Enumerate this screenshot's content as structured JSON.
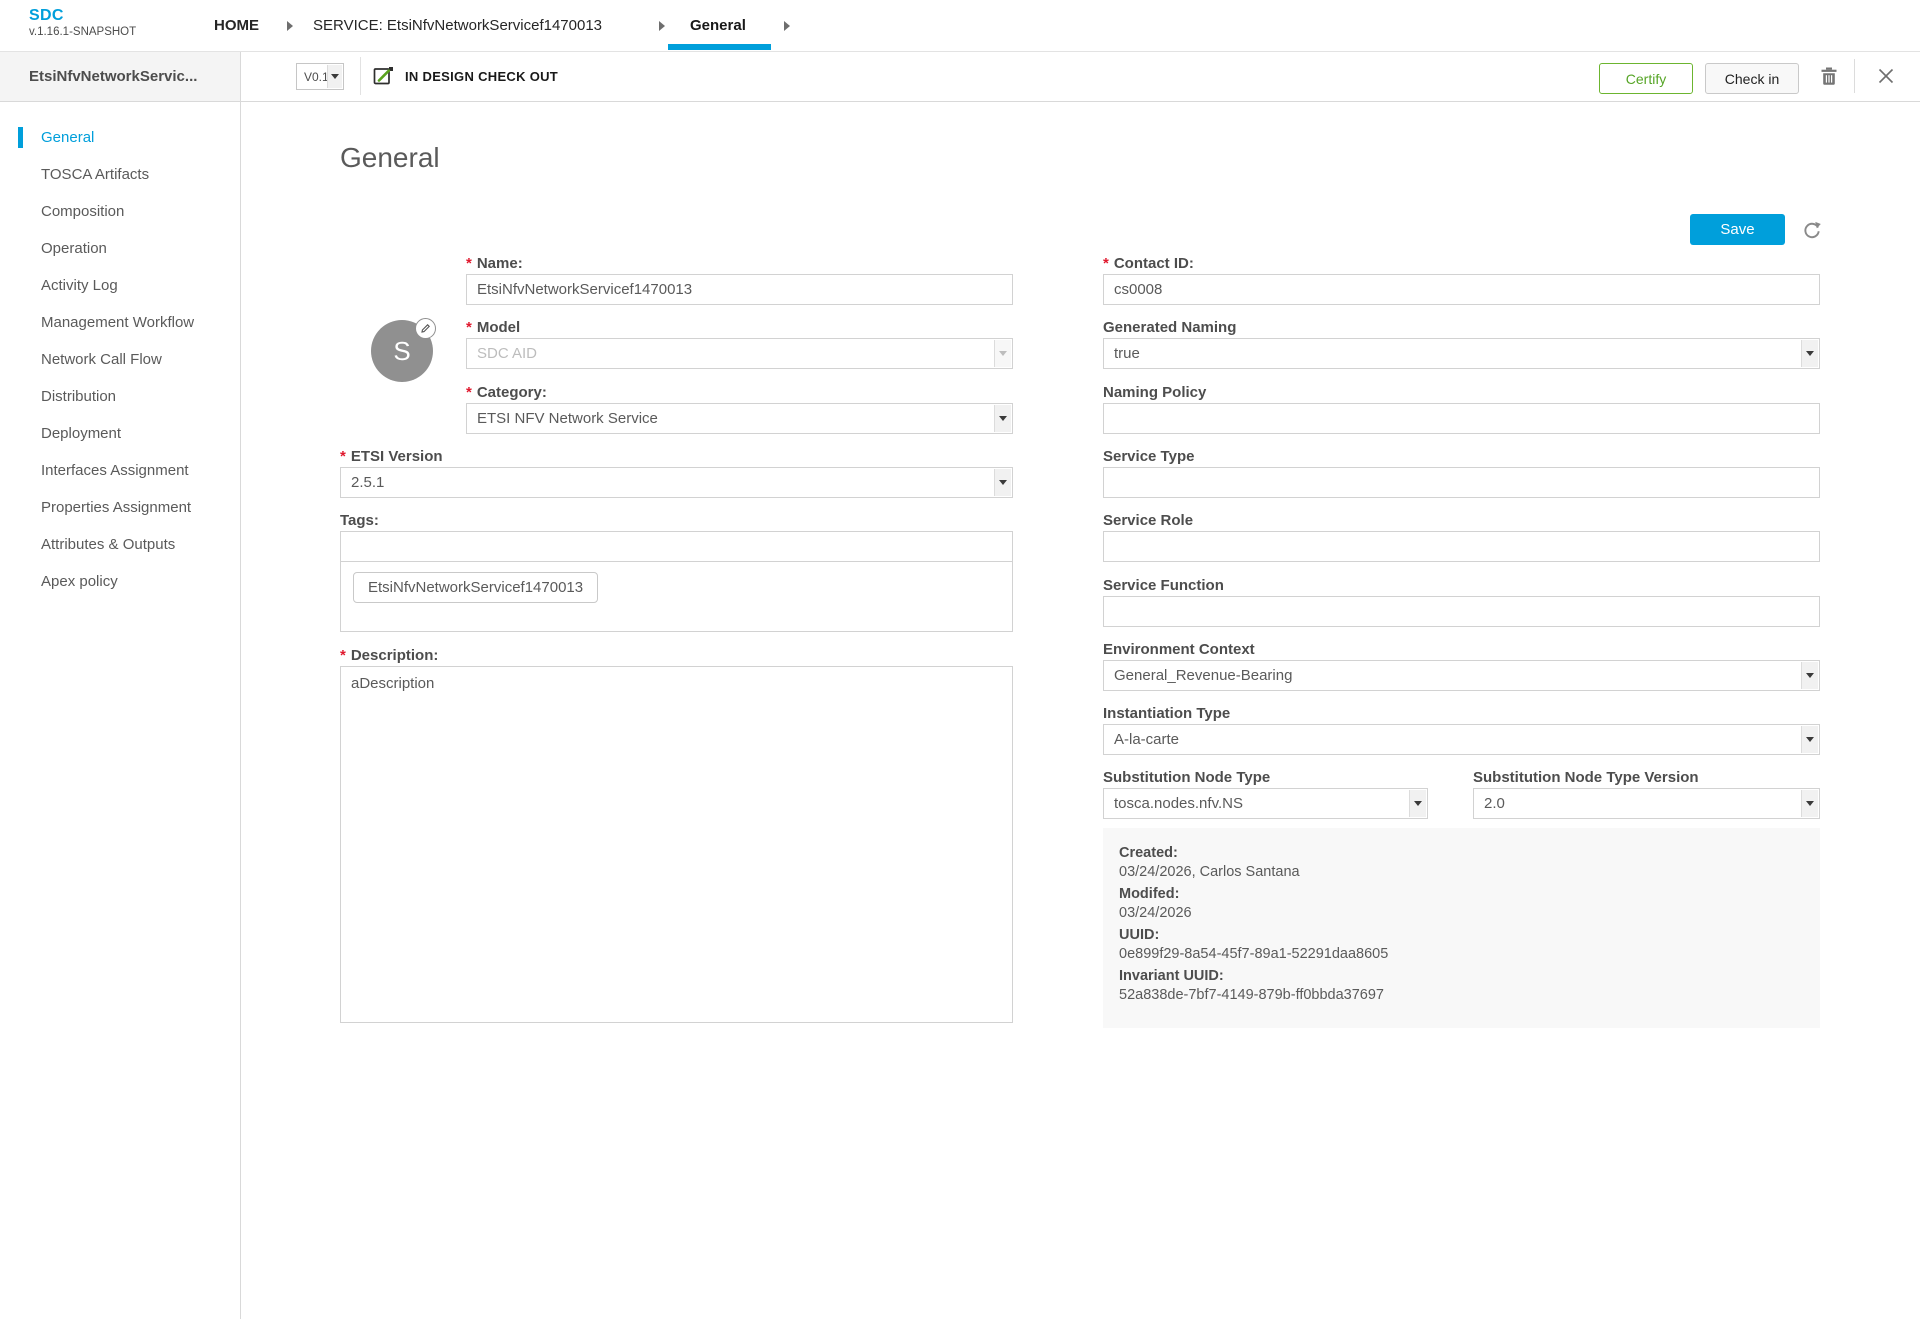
{
  "app": {
    "logo": "SDC",
    "version": "v.1.16.1-SNAPSHOT"
  },
  "breadcrumbs": {
    "home": "HOME",
    "service": "SERVICE: EtsiNfvNetworkServicef1470013",
    "current": "General"
  },
  "toolbar": {
    "entity_name": "EtsiNfvNetworkServic...",
    "version_selected": "V0.1",
    "status": "IN DESIGN CHECK OUT",
    "certify_label": "Certify",
    "checkin_label": "Check in"
  },
  "sidebar": {
    "items": [
      "General",
      "TOSCA Artifacts",
      "Composition",
      "Operation",
      "Activity Log",
      "Management Workflow",
      "Network Call Flow",
      "Distribution",
      "Deployment",
      "Interfaces Assignment",
      "Properties Assignment",
      "Attributes & Outputs",
      "Apex policy"
    ],
    "active": "General"
  },
  "page": {
    "title": "General",
    "save_label": "Save",
    "required_marker": "*"
  },
  "avatar": {
    "letter": "S"
  },
  "form": {
    "name": {
      "label": "Name:",
      "value": "EtsiNfvNetworkServicef1470013"
    },
    "model": {
      "label": "Model",
      "value": "SDC AID"
    },
    "category": {
      "label": "Category:",
      "value": "ETSI NFV Network Service"
    },
    "etsi_version": {
      "label": "ETSI Version",
      "value": "2.5.1"
    },
    "tags": {
      "label": "Tags:",
      "value": "",
      "chip": "EtsiNfvNetworkServicef1470013"
    },
    "description": {
      "label": "Description:",
      "value": "aDescription"
    },
    "contact_id": {
      "label": "Contact ID:",
      "value": "cs0008"
    },
    "generated_naming": {
      "label": "Generated Naming",
      "value": "true"
    },
    "naming_policy": {
      "label": "Naming Policy",
      "value": ""
    },
    "service_type": {
      "label": "Service Type",
      "value": ""
    },
    "service_role": {
      "label": "Service Role",
      "value": ""
    },
    "service_function": {
      "label": "Service Function",
      "value": ""
    },
    "environment_context": {
      "label": "Environment Context",
      "value": "General_Revenue-Bearing"
    },
    "instantiation_type": {
      "label": "Instantiation Type",
      "value": "A-la-carte"
    },
    "substitution_node_type": {
      "label": "Substitution Node Type",
      "value": "tosca.nodes.nfv.NS"
    },
    "substitution_node_type_version": {
      "label": "Substitution Node Type Version",
      "value": "2.0"
    }
  },
  "meta": {
    "created_label": "Created:",
    "created_value": "03/24/2026, Carlos Santana",
    "modified_label": "Modifed:",
    "modified_value": "03/24/2026",
    "uuid_label": "UUID:",
    "uuid_value": "0e899f29-8a54-45f7-89a1-52291daa8605",
    "invariant_uuid_label": "Invariant UUID:",
    "invariant_uuid_value": "52a838de-7bf7-4149-879b-ff0bbda37697"
  },
  "colors": {
    "accent": "#009fdb",
    "certify_green": "#6cb52f",
    "required_red": "#e0182d"
  }
}
